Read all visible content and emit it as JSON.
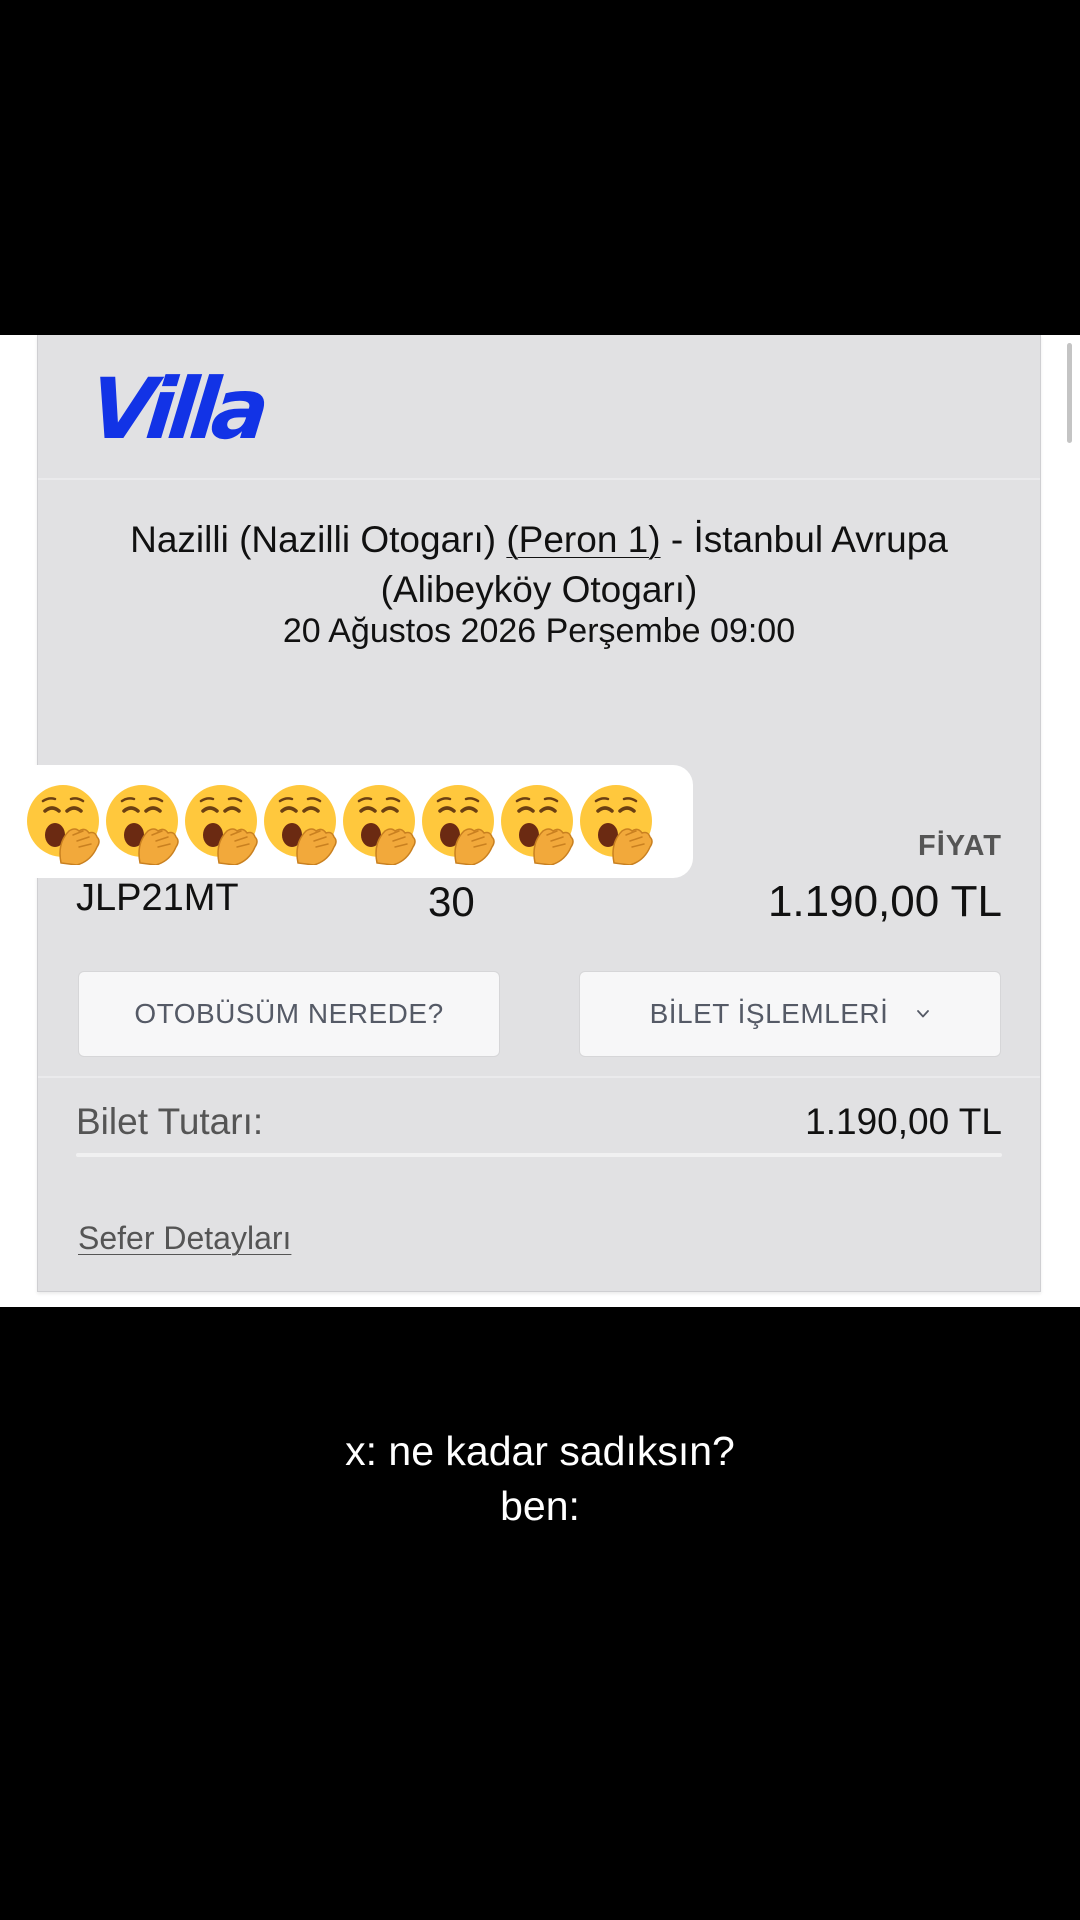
{
  "ticket": {
    "brand": "Villa",
    "route_from": "Nazilli (Nazilli Otogarı)",
    "platform": "(Peron 1)",
    "route_sep": " - ",
    "route_to_line1": "İstanbul Avrupa",
    "route_to_line2": "(Alibeyköy Otogarı)",
    "datetime": "20 Ağustos 2026 Perşembe 09:00",
    "price_header": "FİYAT",
    "pnr": "JLP21MT",
    "seat": "30",
    "price": "1.190,00 TL",
    "where_button": "OTOBÜSÜM NEREDE?",
    "ops_button": "BİLET İŞLEMLERİ",
    "total_label": "Bilet Tutarı:",
    "total_value": "1.190,00 TL",
    "details_link": "Sefer Detayları"
  },
  "overlay": {
    "emoji_count": 8,
    "emoji_icon": "yawning-face-emoji",
    "caption_line1": "x: ne kadar sadıksın?",
    "caption_line2": "ben:"
  },
  "colors": {
    "brand_blue": "#1233e6",
    "accent_red": "#e8262e",
    "card_bg": "#e1e1e3",
    "emoji_yellow": "#ffc83d"
  }
}
